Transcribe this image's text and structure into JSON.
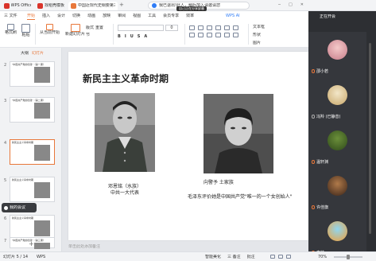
{
  "titlebar": {
    "tabs": [
      {
        "label": "WPS Office",
        "active": false,
        "color": "#d9342b"
      },
      {
        "label": "找稻壳模板",
        "active": false,
        "color": "#d9342b"
      },
      {
        "label": "中国近现代史纲要第三大革命f...",
        "active": true,
        "color": "#e8773a"
      }
    ],
    "add_label": "+"
  },
  "menubar": {
    "file_label": "三 文件",
    "items": [
      "开始",
      "插入",
      "设计",
      "切换",
      "动画",
      "放映",
      "审阅",
      "视图",
      "工具",
      "会员专享",
      "效率"
    ],
    "active_index": 0,
    "wps_ai_label": "WPS AI"
  },
  "notification": {
    "text": "我已退出!此人，稍后加入请邀请您",
    "subtext": "自己正在分享屏幕"
  },
  "ribbon": {
    "paste_label": "格式刷",
    "buttons": [
      "格式刷",
      "粘贴",
      "从当前开始",
      "新建幻灯片",
      "版式",
      "节",
      "重置"
    ],
    "format_labels": [
      "B",
      "I",
      "U",
      "S",
      "A"
    ],
    "right_buttons": [
      "文本框",
      "形状",
      "图片"
    ],
    "font_size": "0"
  },
  "leftpanel": {
    "tabs": [
      "大纲",
      "幻灯片"
    ],
    "slides": [
      {
        "num": "2",
        "title": "\"中国共产党的创建\"（第一课）"
      },
      {
        "num": "3",
        "title": "\"中国共产党的创建\"（第二课）"
      },
      {
        "num": "4",
        "title": "新民主主义革命时期",
        "selected": true
      },
      {
        "num": "5",
        "title": "新民主主义革命时期"
      },
      {
        "num": "6",
        "title": "新民主主义革命时期"
      },
      {
        "num": "7",
        "title": "\"中国共产党的创建\"（第三课）"
      }
    ],
    "popup_label": "我的会议",
    "add_label": "+"
  },
  "slide": {
    "title": "新民主主义革命时期",
    "person1": {
      "name": "邓恩铭（水族）",
      "role": "中共一大代表"
    },
    "person2": {
      "name": "向警予 土家族",
      "quote": "毛泽东评价她是中国共产党\"唯一的一个女创始人\""
    }
  },
  "notes_placeholder": "单击此处添加备注",
  "videopanel": {
    "header": "正在开会",
    "participants": [
      {
        "name": "邵小若",
        "muted": false
      },
      {
        "name": "冯羚 (已静音)",
        "muted": true
      },
      {
        "name": "温轩渊",
        "muted": false
      },
      {
        "name": "许佳旗",
        "muted": false
      },
      {
        "name": "李楠",
        "muted": false
      }
    ]
  },
  "statusbar": {
    "slide_indicator": "幻灯片 5 / 14",
    "theme": "WPS",
    "right_items": [
      "智能美化",
      "三 备注",
      "批注"
    ],
    "zoom": "70%"
  },
  "colors": {
    "accent": "#e8773a",
    "brand_red": "#d9342b",
    "panel_dark": "#2d2f33"
  }
}
